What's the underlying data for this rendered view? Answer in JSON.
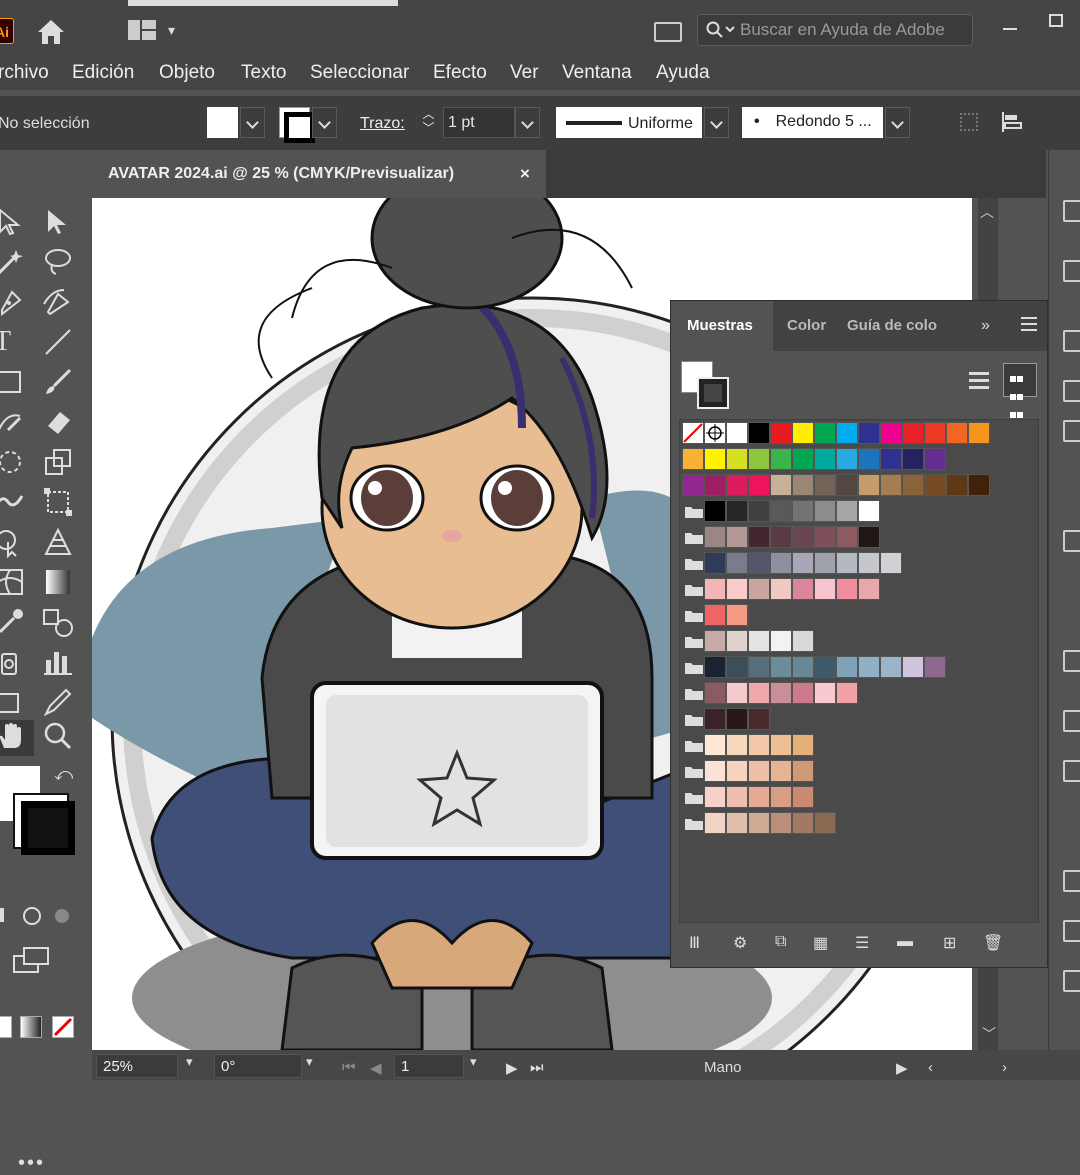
{
  "app": {
    "logo_text": "Ai"
  },
  "search": {
    "placeholder": "Buscar en Ayuda de Adobe"
  },
  "menu": {
    "items": [
      "rchivo",
      "Edición",
      "Objeto",
      "Texto",
      "Seleccionar",
      "Efecto",
      "Ver",
      "Ventana",
      "Ayuda"
    ]
  },
  "control": {
    "selection_status": "No selección",
    "stroke_label": "Trazo:",
    "stroke_weight": "1 pt",
    "profile": "Uniforme",
    "brush": "Redondo 5 ..."
  },
  "document": {
    "tab_title": "AVATAR 2024.ai @ 25 % (CMYK/Previsualizar)",
    "close_glyph": "×"
  },
  "swatches": {
    "tabs": [
      "Muestras",
      "Color",
      "Guía de colo"
    ],
    "active_tab": "Muestras",
    "rows": [
      {
        "folder": false,
        "colors": [
          "none",
          "registration",
          "#ffffff",
          "#000000",
          "#e8191f",
          "#ffee00",
          "#00a651",
          "#00aeef",
          "#2e3192",
          "#ec008c",
          "#e82127",
          "#ee3a24",
          "#f26522",
          "#f7941d"
        ]
      },
      {
        "folder": false,
        "colors": [
          "#f8b133",
          "#fff200",
          "#d7df23",
          "#8dc63f",
          "#39b54a",
          "#00a651",
          "#00a99d",
          "#27aae1",
          "#1c75bc",
          "#2e3192",
          "#262262",
          "#662d91"
        ]
      },
      {
        "folder": false,
        "colors": [
          "#92278f",
          "#9e1f63",
          "#da1c5c",
          "#ed145b",
          "#c7b299",
          "#998675",
          "#736357",
          "#534741",
          "#c69c6d",
          "#a67c52",
          "#8c6239",
          "#754c24",
          "#603813",
          "#42210b"
        ]
      },
      {
        "folder": true,
        "colors": [
          "#000000",
          "#262626",
          "#404040",
          "#595959",
          "#737373",
          "#8c8c8c",
          "#a6a6a6",
          "#ffffff"
        ]
      },
      {
        "folder": true,
        "colors": [
          "#9b8686",
          "#b39995",
          "#43262e",
          "#5c3a43",
          "#6a4652",
          "#7e515a",
          "#8d5a62",
          "#211616"
        ]
      },
      {
        "folder": true,
        "colors": [
          "#2f3b59",
          "#7a7b8d",
          "#55566a",
          "#8f8fa2",
          "#a7a7b7",
          "#9ea1ab",
          "#b3b9c0",
          "#c5c7cc",
          "#cfd1d4"
        ]
      },
      {
        "folder": true,
        "colors": [
          "#f2b6b6",
          "#f9cbcb",
          "#c9a4a0",
          "#efc8c2",
          "#d9869b",
          "#f7c3cf",
          "#f08c9c",
          "#e8a7ad"
        ]
      },
      {
        "folder": true,
        "colors": [
          "#ef6464",
          "#f49a80"
        ]
      },
      {
        "folder": true,
        "colors": [
          "#c4aba6",
          "#e0d2cd",
          "#e6e3e3",
          "#f4f1f1",
          "#d9d9d9"
        ]
      },
      {
        "folder": true,
        "colors": [
          "#1a2233",
          "#3c4e5c",
          "#566f7d",
          "#6b8c9b",
          "#698896",
          "#3e5a68",
          "#7ea3b8",
          "#8fb1c6",
          "#9bb4cc",
          "#cfc6dd",
          "#8d6891"
        ]
      },
      {
        "folder": true,
        "colors": [
          "#8c5a62",
          "#f6c9cd",
          "#f2a8aa",
          "#c98e98",
          "#cd7a8a",
          "#f7c9d1",
          "#f2a1a6"
        ]
      },
      {
        "folder": true,
        "colors": [
          "#3a2427",
          "#2a1819",
          "#4a2a2d"
        ]
      },
      {
        "folder": true,
        "colors": [
          "#fde8d6",
          "#f8d8bc",
          "#f2c8a8",
          "#eebf92",
          "#e6ae79"
        ]
      },
      {
        "folder": true,
        "colors": [
          "#fbe2d6",
          "#f7d2bf",
          "#efc0a7",
          "#e6b393",
          "#cf9a75"
        ]
      },
      {
        "folder": true,
        "colors": [
          "#f6d0c9",
          "#f1bdb1",
          "#e8a996",
          "#d99d83",
          "#c98a71"
        ]
      },
      {
        "folder": true,
        "colors": [
          "#f0d5c6",
          "#e0bfad",
          "#cfab95",
          "#b98f78",
          "#a27a61",
          "#8c6a52"
        ]
      }
    ]
  },
  "statusbar": {
    "zoom": "25%",
    "rotation": "0°",
    "artboard": "1",
    "tool": "Mano"
  },
  "colors": {
    "accent_ui": "#535353",
    "panel_dark": "#454545",
    "canvas": "#ffffff"
  }
}
